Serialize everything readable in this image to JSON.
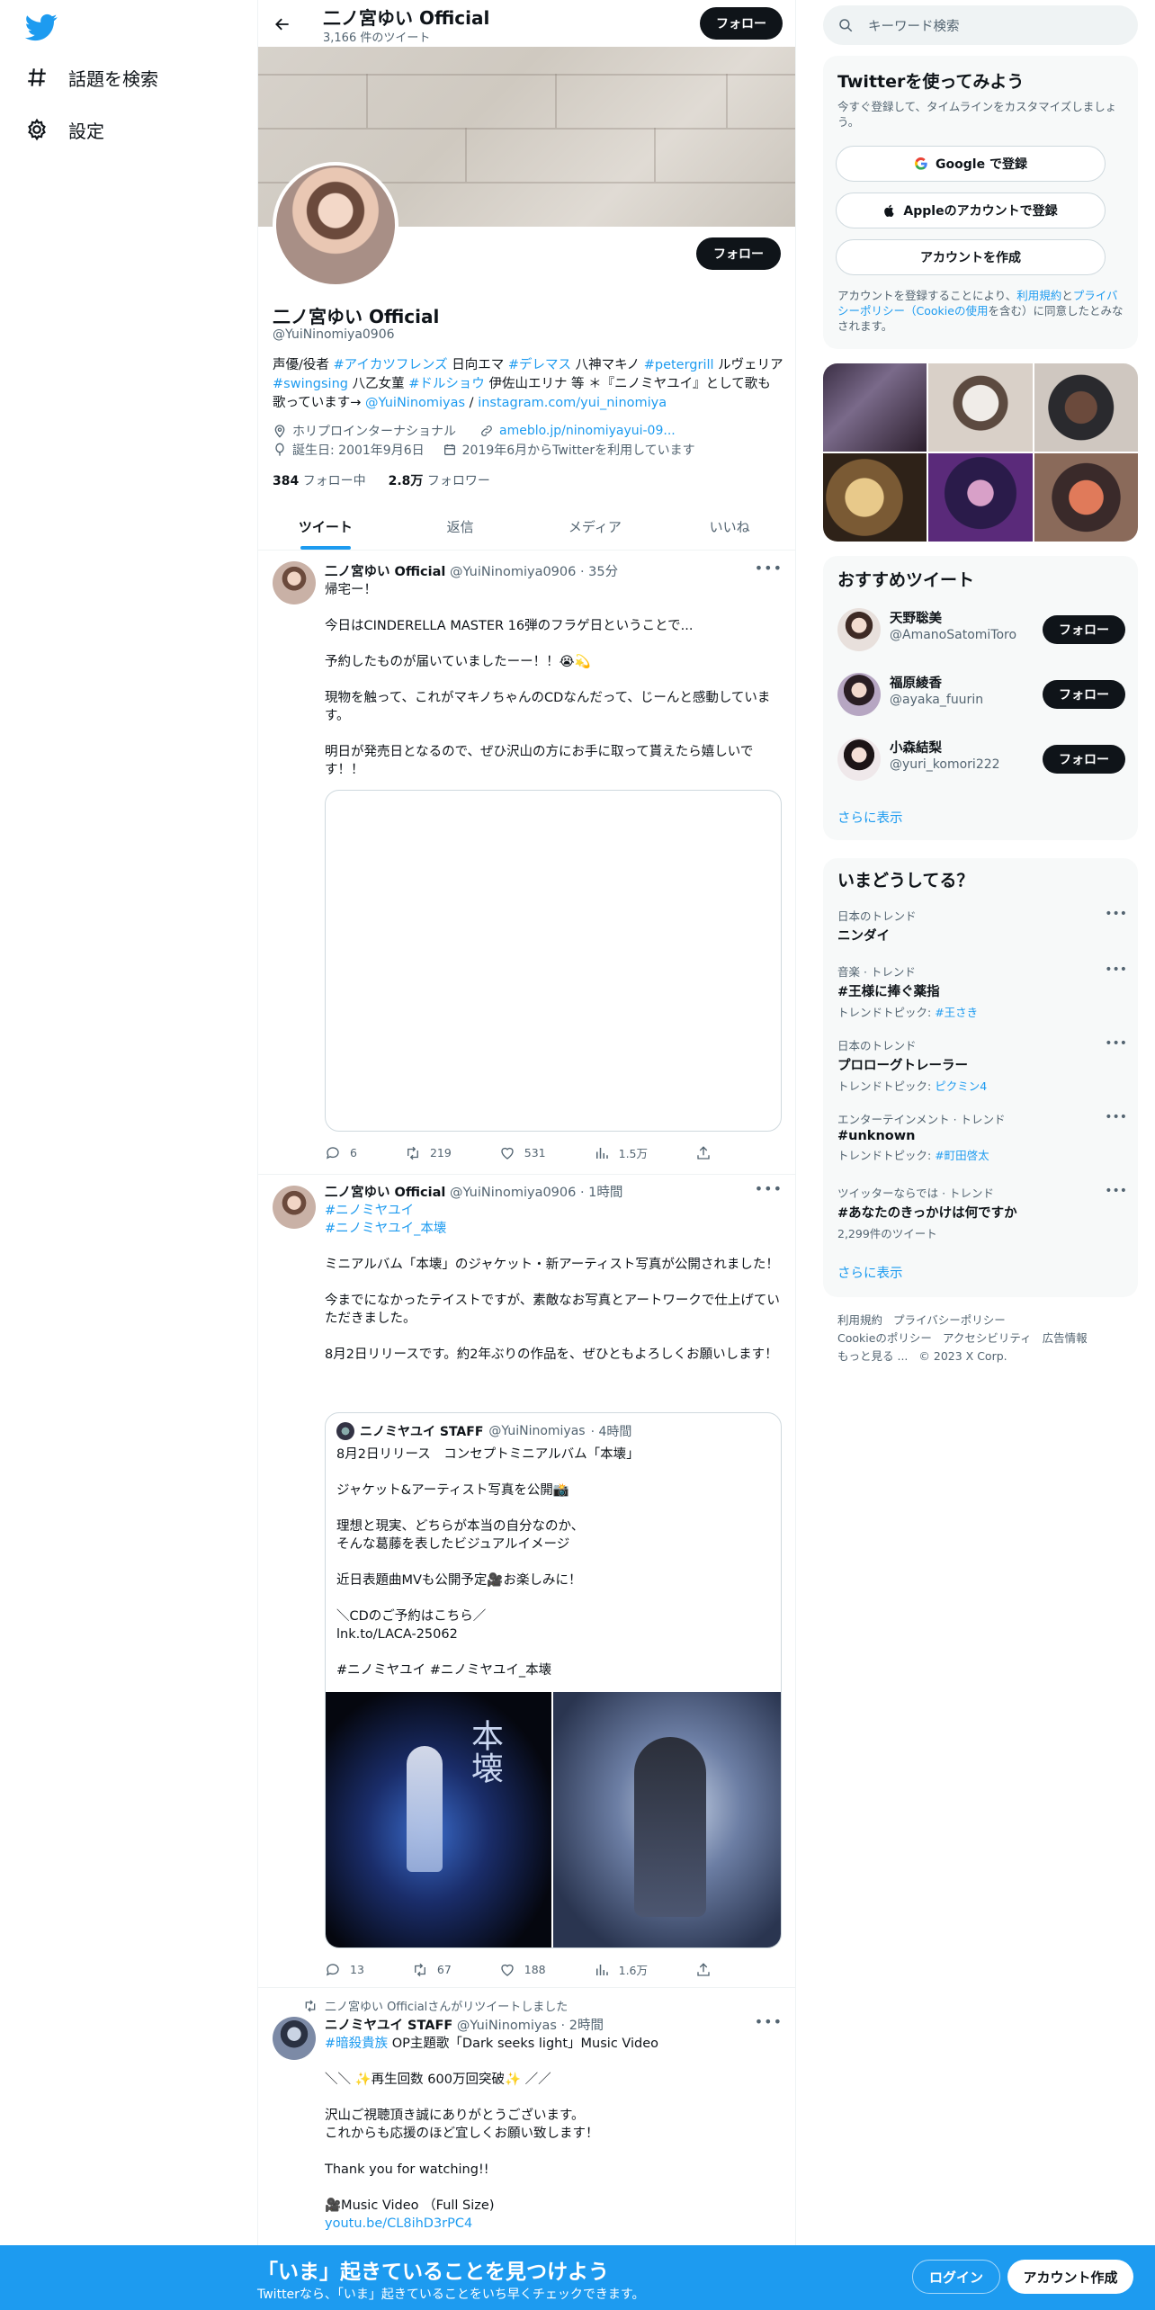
{
  "nav": {
    "explore_label": "話題を検索",
    "settings_label": "設定"
  },
  "header": {
    "title": "二ノ宮ゆい Official",
    "tweet_count": "3,166 件のツイート",
    "follow_label": "フォロー"
  },
  "profile": {
    "name": "二ノ宮ゆい Official",
    "handle": "@YuiNinomiya0906",
    "follow_label": "フォロー",
    "bio": {
      "p1": "声優/役者 ",
      "h1": "#アイカツフレンズ",
      "p2": " 日向エマ ",
      "h2": "#デレマス",
      "p3": " 八神マキノ ",
      "h3": "#petergrill",
      "p4": " ルヴェリア ",
      "h4": "#swingsing",
      "p5": " 八乙女菫 ",
      "h5": "#ドルショウ",
      "p6": " 伊佐山エリナ 等 ＊『ニノミヤユイ』として歌も歌っています→ ",
      "l1": "@YuiNinomiyas",
      "p7": " / ",
      "l2": "instagram.com/yui_ninomiya"
    },
    "location": "ホリプロインターナショナル",
    "website": "ameblo.jp/ninomiyayui-09...",
    "birthday": "誕生日: 2001年9月6日",
    "joined": "2019年6月からTwitterを利用しています",
    "following_count": "384",
    "following_label": "フォロー中",
    "followers_count": "2.8万",
    "followers_label": "フォロワー"
  },
  "tabs": [
    {
      "label": "ツイート"
    },
    {
      "label": "返信"
    },
    {
      "label": "メディア"
    },
    {
      "label": "いいね"
    }
  ],
  "tweets": [
    {
      "name": "二ノ宮ゆい Official",
      "handle": "@YuiNinomiya0906",
      "time": "· 35分",
      "text": "帰宅ー！\n\n今日はCINDERELLA MASTER 16弾のフラゲ日ということで...\n\n予約したものが届いていましたーー！！😭💫\n\n現物を触って、これがマキノちゃんのCDなんだって、じーんと感動しています。\n\n明日が発売日となるので、ぜひ沢山の方にお手に取って貰えたら嬉しいです！！",
      "replies": "6",
      "retweets": "219",
      "likes": "531",
      "views": "1.5万"
    },
    {
      "name": "二ノ宮ゆい Official",
      "handle": "@YuiNinomiya0906",
      "time": "· 1時間",
      "hashtag1": "#ニノミヤユイ",
      "hashtag2": "#ニノミヤユイ_本壊",
      "text": "ミニアルバム「本壊」のジャケット・新アーティスト写真が公開されました！\n\n今までになかったテイストですが、素敵なお写真とアートワークで仕上げていただきました。\n\n8月2日リリースです。約2年ぶりの作品を、ぜひともよろしくお願いします！",
      "quote": {
        "name": "ニノミヤユイ STAFF",
        "handle": "@YuiNinomiyas",
        "time": "· 4時間",
        "text": "8月2日リリース　コンセプトミニアルバム「本壊」\n\nジャケット&アーティスト写真を公開📸\n\n理想と現実、どちらが本当の自分なのか、\nそんな葛藤を表したビジュアルイメージ\n\n近日表題曲MVも公開予定🎥お楽しみに！\n\n＼CDのご予約はこちら／\nlnk.to/LACA-25062\n\n#ニノミヤユイ #ニノミヤユイ_本壊",
        "image_text": "本壊"
      },
      "replies": "13",
      "retweets": "67",
      "likes": "188",
      "views": "1.6万"
    },
    {
      "retweeted_by": "二ノ宮ゆい Officialさんがリツイートしました",
      "name": "ニノミヤユイ STAFF",
      "handle": "@YuiNinomiyas",
      "time": "· 2時間",
      "hashtag": "#暗殺貴族",
      "text_after_hashtag": " OP主題歌「Dark seeks light」Music Video",
      "text": "＼＼ ✨再生回数 600万回突破✨ ／／\n\n沢山ご視聴頂き誠にありがとうございます。\nこれからも応援のほど宜しくお願い致します！\n\nThank you for watching!!\n\n🎥Music Video （Full Size)",
      "link": "youtu.be/CL8ihD3rPC4"
    }
  ],
  "search": {
    "placeholder": "キーワード検索"
  },
  "signup_card": {
    "title": "Twitterを使ってみよう",
    "desc": "今すぐ登録して、タイムラインをカスタマイズしましょう。",
    "google": "Google で登録",
    "apple": "Appleのアカウントで登録",
    "create": "アカウントを作成",
    "terms_p1": "アカウントを登録することにより、",
    "terms_l1": "利用規約",
    "terms_p2": "と",
    "terms_l2": "プライバシーポリシー",
    "terms_l3": "（Cookieの使用",
    "terms_p3": "を含む）に同意したとみなされます。"
  },
  "recommend": {
    "title": "おすすめツイート",
    "users": [
      {
        "name": "天野聡美",
        "handle": "@AmanoSatomiToro",
        "follow": "フォロー"
      },
      {
        "name": "福原綾香",
        "handle": "@ayaka_fuurin",
        "follow": "フォロー"
      },
      {
        "name": "小森結梨",
        "handle": "@yuri_komori222",
        "follow": "フォロー"
      }
    ],
    "more": "さらに表示"
  },
  "trends": {
    "title": "いまどうしてる？",
    "items": [
      {
        "category": "日本のトレンド",
        "name": "ニンダイ",
        "extra_label": "",
        "extra_link": ""
      },
      {
        "category": "音楽 · トレンド",
        "name": "#王様に捧ぐ薬指",
        "extra_label": "トレンドトピック: ",
        "extra_link": "#王さき"
      },
      {
        "category": "日本のトレンド",
        "name": "プロローグトレーラー",
        "extra_label": "トレンドトピック: ",
        "extra_link": "ピクミン4"
      },
      {
        "category": "エンターテインメント · トレンド",
        "name": "#unknown",
        "extra_label": "トレンドトピック: ",
        "extra_link": "#町田啓太"
      },
      {
        "category": "ツイッターならでは · トレンド",
        "name": "#あなたのきっかけは何ですか",
        "extra_label": "2,299件のツイート",
        "extra_link": ""
      }
    ],
    "more": "さらに表示"
  },
  "footer": {
    "terms": "利用規約",
    "privacy": "プライバシーポリシー",
    "cookie": "Cookieのポリシー",
    "accessibility": "アクセシビリティ",
    "ads": "広告情報",
    "more": "もっと見る ...",
    "copyright": "© 2023 X Corp."
  },
  "bottom_bar": {
    "headline": "「いま」起きていることを見つけよう",
    "subline": "Twitterなら、「いま」起きていることをいち早くチェックできます。",
    "login": "ログイン",
    "signup": "アカウント作成"
  },
  "colors": {
    "accent": "#1d9bf0",
    "text": "#0f1419",
    "muted": "#536471"
  }
}
